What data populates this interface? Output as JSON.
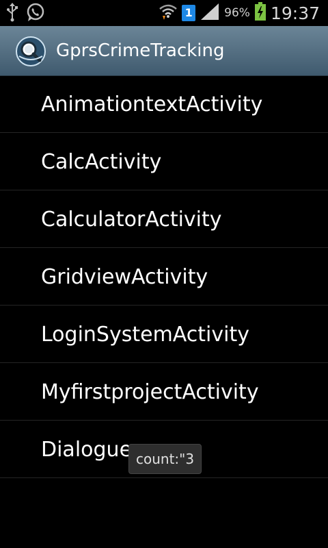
{
  "status_bar": {
    "icons_left": [
      "usb-icon",
      "whatsapp-icon"
    ],
    "icons_right": [
      "wifi-icon",
      "sim-1-icon",
      "signal-icon",
      "battery-charging-icon"
    ],
    "sim_label": "1",
    "battery_percent": "96%",
    "time": "19:37"
  },
  "action_bar": {
    "title": "GprsCrimeTracking",
    "icon": "magnifier-globe-icon"
  },
  "activities": [
    {
      "label": "AnimationtextActivity"
    },
    {
      "label": "CalcActivity"
    },
    {
      "label": "CalculatorActivity"
    },
    {
      "label": "GridviewActivity"
    },
    {
      "label": "LoginSystemActivity"
    },
    {
      "label": "MyfirstprojectActivity"
    },
    {
      "label": "Dialogue"
    }
  ],
  "toast": {
    "text": "count:\"3"
  },
  "colors": {
    "background": "#000000",
    "action_bar_top": "#6b8597",
    "action_bar_bottom": "#3f5a6e",
    "sim_badge": "#1e88e5",
    "battery_charging": "#7cc242"
  }
}
